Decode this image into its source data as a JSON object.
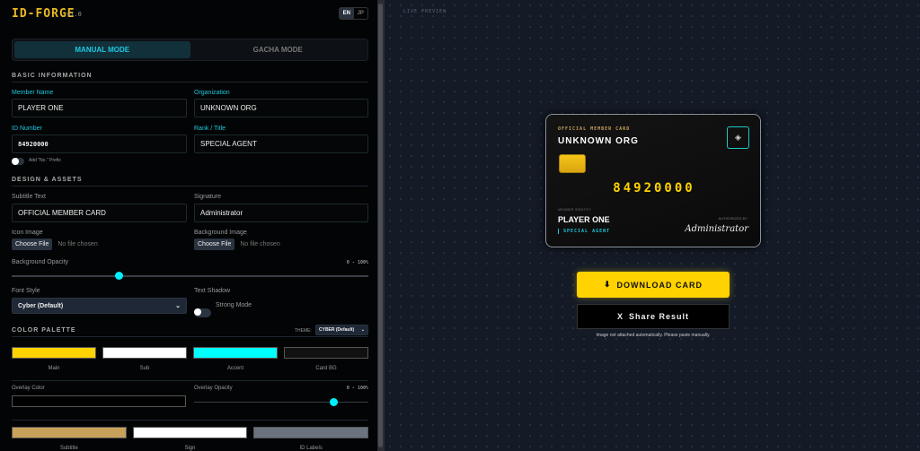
{
  "header": {
    "logo": "ID-FORGE",
    "version": "v1.0",
    "lang": [
      "EN",
      "JP"
    ]
  },
  "modes": [
    "MANUAL MODE",
    "GACHA MODE"
  ],
  "basic": {
    "title": "BASIC INFORMATION",
    "member_name_label": "Member Name",
    "member_name": "PLAYER ONE",
    "org_label": "Organization",
    "org": "UNKNOWN ORG",
    "id_label": "ID Number",
    "id": "84920000",
    "rank_label": "Rank / Title",
    "rank": "SPECIAL AGENT",
    "prefix_label": "Add \"No.\" Prefix"
  },
  "design": {
    "title": "DESIGN & ASSETS",
    "subtitle_label": "Subtitle Text",
    "subtitle": "OFFICIAL MEMBER CARD",
    "signature_label": "Signature",
    "signature": "Administrator",
    "icon_label": "Icon Image",
    "bg_label": "Background Image",
    "choose": "Choose File",
    "no_file": "No file chosen",
    "opacity_label": "Background Opacity",
    "opacity_range": "0 - 100%",
    "bg_opacity": 0.3,
    "font_label": "Font Style",
    "font": "Cyber (Default)",
    "shadow_label": "Text Shadow",
    "shadow": "Strong Mode"
  },
  "palette": {
    "title": "COLOR PALETTE",
    "theme_label": "THEME:",
    "theme": "CYBER (Default)",
    "swatches": [
      {
        "label": "Main",
        "color": "#ffd200"
      },
      {
        "label": "Sub",
        "color": "#ffffff"
      },
      {
        "label": "Accent",
        "color": "#00ffff"
      },
      {
        "label": "Card BG",
        "color": "#111111"
      }
    ],
    "overlay_label": "Overlay Color",
    "overlay_color": "#000000",
    "overlay_opacity_label": "Overlay Opacity",
    "overlay_range": "0 - 100%",
    "overlay_opacity": 0.8,
    "swatches2": [
      {
        "label": "Subtitle",
        "color": "#c8a25a"
      },
      {
        "label": "Sign",
        "color": "#ffffff"
      },
      {
        "label": "ID Labels",
        "color": "#6b7280"
      }
    ]
  },
  "preview": {
    "label": "LIVE PREVIEW",
    "card": {
      "subtitle": "OFFICIAL MEMBER CARD",
      "org": "UNKNOWN ORG",
      "id": "84920000",
      "identity_label": "MEMBER IDENTITY",
      "name": "PLAYER ONE",
      "rank": "SPECIAL AGENT",
      "auth_label": "AUTHORIZED BY",
      "signature": "Administrator"
    },
    "download": "DOWNLOAD CARD",
    "share": "Share Result",
    "share_icon": "X",
    "note": "Image not attached automatically. Please paste manually."
  }
}
